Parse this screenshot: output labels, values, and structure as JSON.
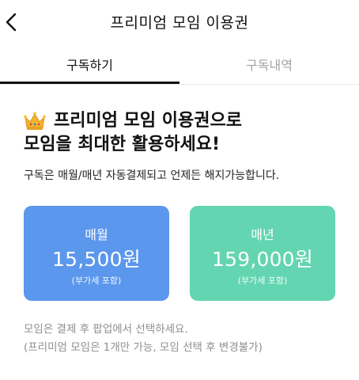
{
  "header": {
    "title": "프리미엄 모임 이용권",
    "back_icon": "chevron-left-icon"
  },
  "tabs": [
    {
      "label": "구독하기",
      "active": true
    },
    {
      "label": "구독내역",
      "active": false
    }
  ],
  "hero": {
    "icon": "crown-icon",
    "line1": "프리미엄 모임 이용권으로",
    "line2": "모임을 최대한 활용하세요!"
  },
  "description": "구독은 매월/매년 자동결제되고 언제든 해지가능합니다.",
  "plans": [
    {
      "name": "매월",
      "price": "15,500원",
      "vat": "(부가세 포함)",
      "color": "#5b97ec"
    },
    {
      "name": "매년",
      "price": "159,000원",
      "vat": "(부가세 포함)",
      "color": "#63d5b0"
    }
  ],
  "notes": {
    "line1": "모임은 결제 후 팝업에서 선택하세요.",
    "line2": "(프리미엄 모임은 1개만 가능, 모임 선택 후 변경불가)"
  }
}
